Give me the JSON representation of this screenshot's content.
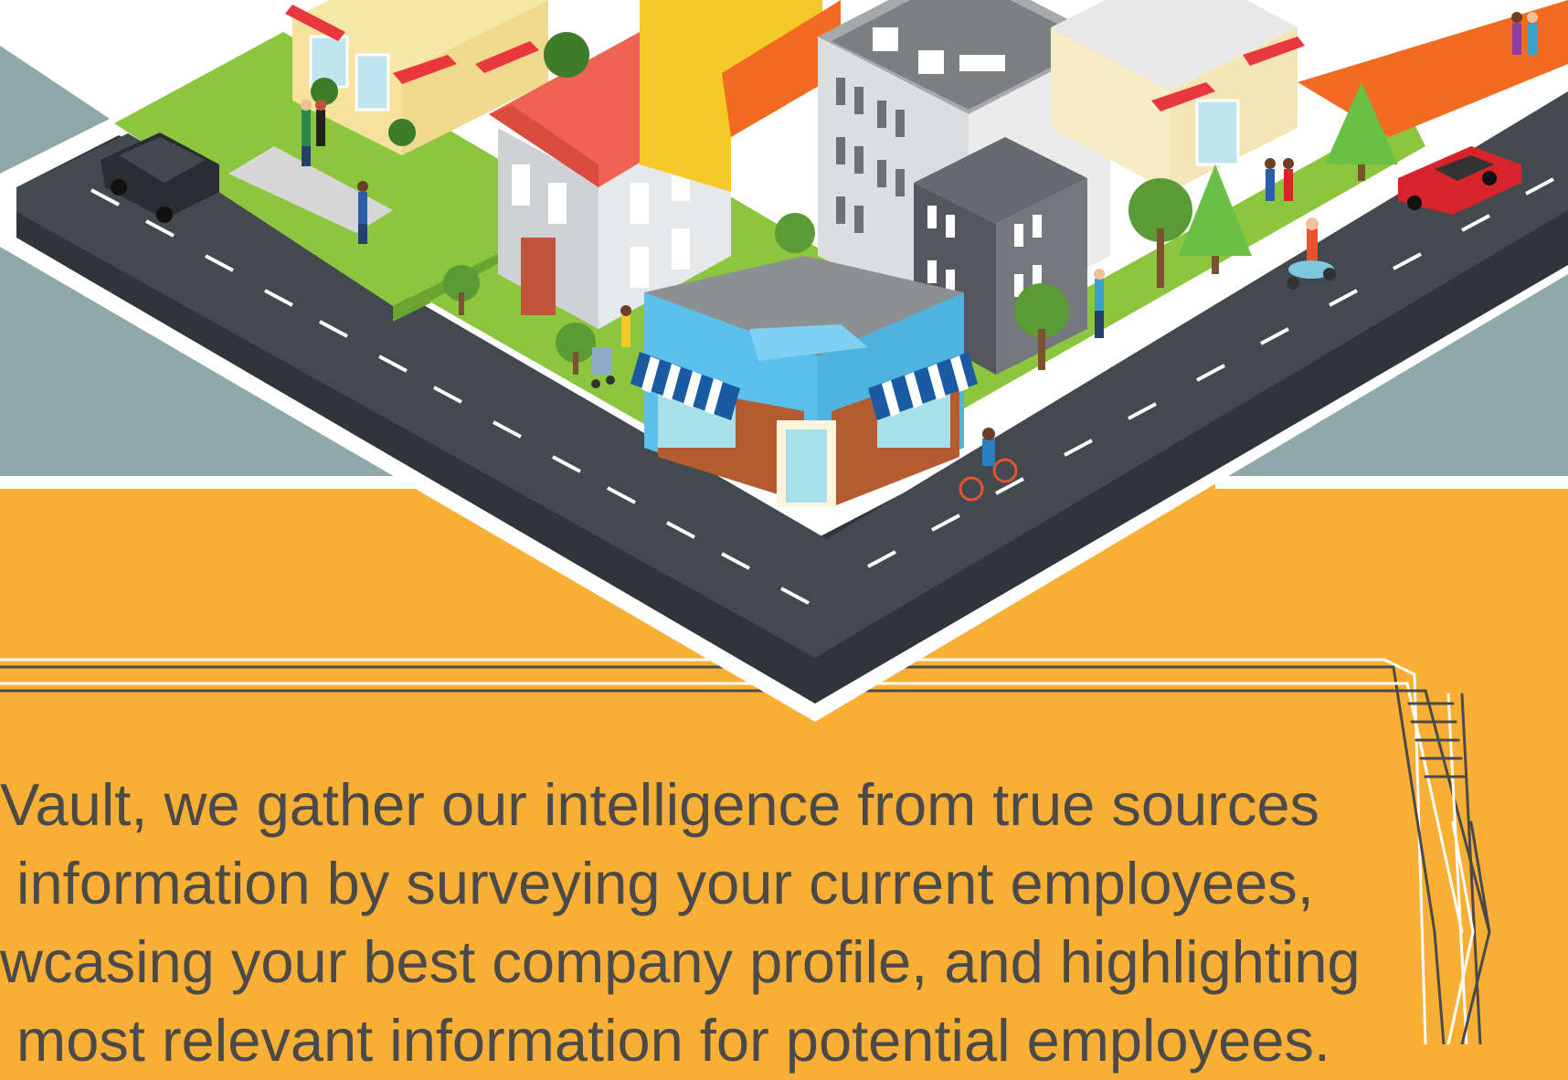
{
  "colors": {
    "background_sky": "#8fa9aa",
    "background_orange": "#f8af33",
    "road": "#424a4f",
    "road_side": "#2f353a",
    "lane_marking": "#ffffff",
    "grass": "#8cc63f",
    "text": "#4a4a4a",
    "outline": "#ffffff",
    "frame_stroke": "#4a4a4a"
  },
  "illustration": {
    "alt": "Isometric city block with streets, shops, houses, trees, cars and pedestrians"
  },
  "body_text": {
    "line1": "Vault, we gather our intelligence from true sources",
    "line2": " information by surveying your current employees,",
    "line3": "wcasing your best company profile, and highlighting",
    "line4": " most relevant information for potential employees."
  }
}
